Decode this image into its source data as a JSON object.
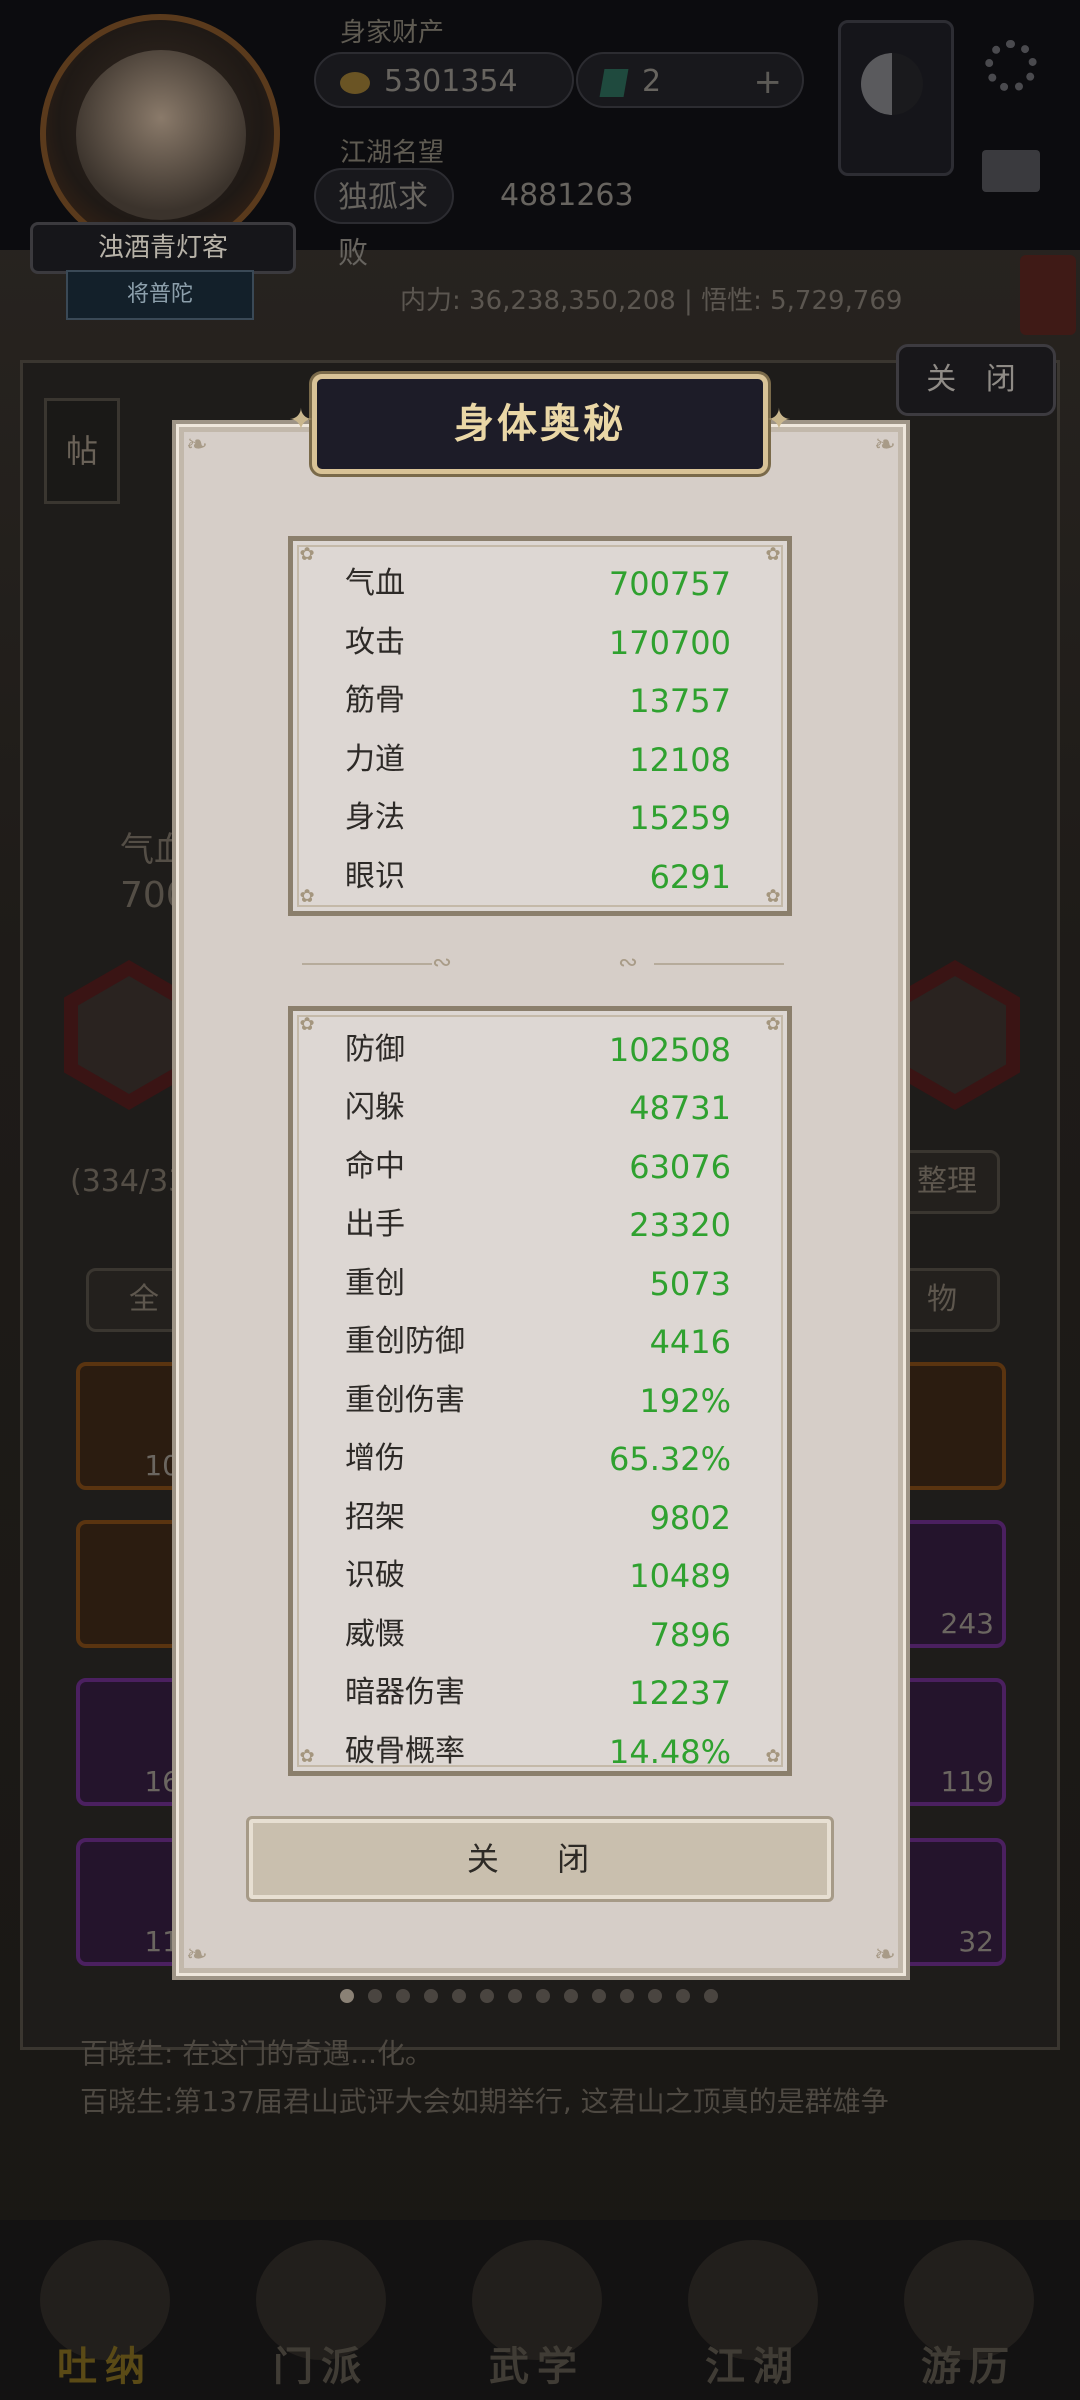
{
  "header": {
    "assets_label": "身家财产",
    "coins": "5301354",
    "gems": "2",
    "plus_label": "+",
    "reputation_label": "江湖名望",
    "rank_title": "独孤求败",
    "reputation_value": "4881263",
    "player_name": "浊酒青灯客",
    "player_sub": "将普陀",
    "power_line": "内力: 36,238,350,208 | 悟性: 5,729,769"
  },
  "background": {
    "close_button": "关 闭",
    "side_tab": "帖",
    "hp_label": "气血",
    "hp_value": "700",
    "inventory_count": "(334/33",
    "sort_button": "整理",
    "tab_all": "全",
    "tab_items": "物",
    "counts": [
      "10",
      "243",
      "16",
      "119",
      "11",
      "32"
    ],
    "log_lines": [
      "百晓生: 在这门的奇遇...化。",
      "百晓生:第137届君山武评大会如期举行, 这君山之顶真的是群雄争"
    ]
  },
  "modal": {
    "title": "身体奥秘",
    "primary_stats": [
      {
        "name": "气血",
        "value": "700757"
      },
      {
        "name": "攻击",
        "value": "170700"
      },
      {
        "name": "筋骨",
        "value": "13757"
      },
      {
        "name": "力道",
        "value": "12108"
      },
      {
        "name": "身法",
        "value": "15259"
      },
      {
        "name": "眼识",
        "value": "6291"
      }
    ],
    "secondary_stats": [
      {
        "name": "防御",
        "value": "102508"
      },
      {
        "name": "闪躲",
        "value": "48731"
      },
      {
        "name": "命中",
        "value": "63076"
      },
      {
        "name": "出手",
        "value": "23320"
      },
      {
        "name": "重创",
        "value": "5073"
      },
      {
        "name": "重创防御",
        "value": "4416"
      },
      {
        "name": "重创伤害",
        "value": "192%"
      },
      {
        "name": "增伤",
        "value": "65.32%"
      },
      {
        "name": "招架",
        "value": "9802"
      },
      {
        "name": "识破",
        "value": "10489"
      },
      {
        "name": "威慑",
        "value": "7896"
      },
      {
        "name": "暗器伤害",
        "value": "12237"
      },
      {
        "name": "破骨概率",
        "value": "14.48%"
      }
    ],
    "close_label": "关 闭"
  },
  "bottom_nav": [
    {
      "label": "吐纳",
      "active": true
    },
    {
      "label": "门派",
      "active": false
    },
    {
      "label": "武学",
      "active": false
    },
    {
      "label": "江湖",
      "active": false
    },
    {
      "label": "游历",
      "active": false
    }
  ],
  "colors": {
    "stat_value": "#2fa12f",
    "title_text": "#ead7a6",
    "modal_bg": "#d6cec8"
  }
}
